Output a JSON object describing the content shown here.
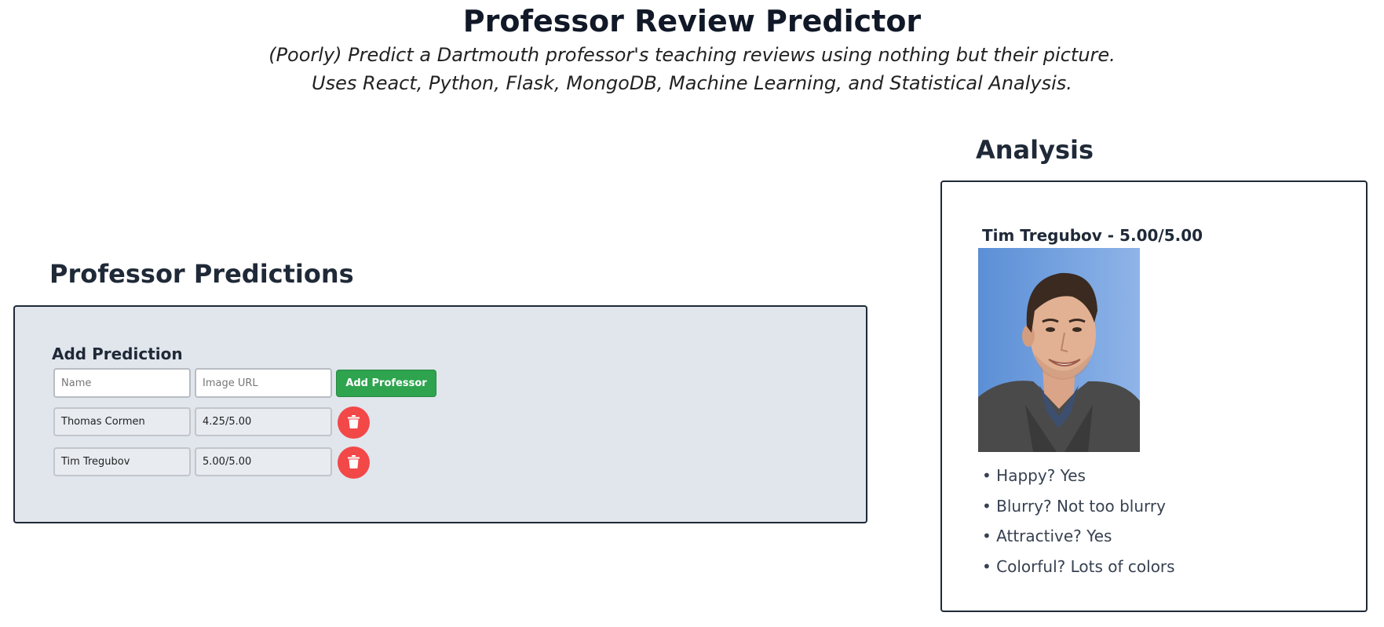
{
  "header": {
    "title": "Professor Review Predictor",
    "subtitle_line1": "(Poorly) Predict a Dartmouth professor's teaching reviews using nothing but their picture.",
    "subtitle_line2": "Uses React, Python, Flask, MongoDB, Machine Learning, and Statistical Analysis."
  },
  "predictions": {
    "heading": "Professor Predictions",
    "add_title": "Add Prediction",
    "name_placeholder": "Name",
    "url_placeholder": "Image URL",
    "add_button_label": "Add Professor",
    "delete_icon": "trash-icon",
    "rows": [
      {
        "name": "Thomas Cormen",
        "score": "4.25/5.00"
      },
      {
        "name": "Tim Tregubov",
        "score": "5.00/5.00"
      }
    ]
  },
  "analysis": {
    "heading": "Analysis",
    "name_score": "Tim Tregubov - 5.00/5.00",
    "traits": [
      "• Happy? Yes",
      "• Blurry? Not too blurry",
      "• Attractive? Yes",
      "• Colorful? Lots of colors"
    ]
  },
  "colors": {
    "accent_green": "#2ea44f",
    "delete_red": "#f24848",
    "panel_bg": "#e1e5ec"
  }
}
